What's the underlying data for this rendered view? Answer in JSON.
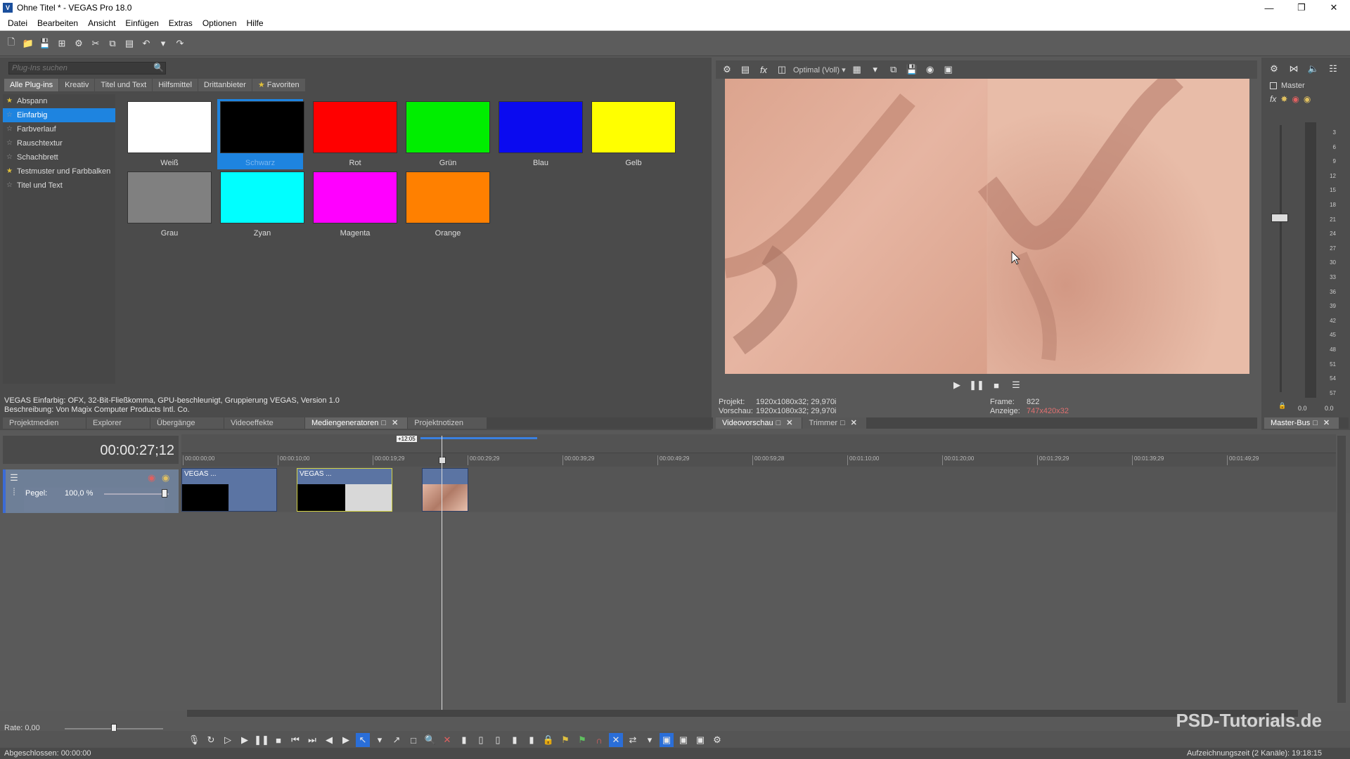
{
  "window": {
    "title": "Ohne Titel * - VEGAS Pro 18.0",
    "icon_letter": "V"
  },
  "menu": [
    "Datei",
    "Bearbeiten",
    "Ansicht",
    "Einfügen",
    "Extras",
    "Optionen",
    "Hilfe"
  ],
  "plugins": {
    "search_placeholder": "Plug-Ins suchen",
    "tabs": [
      "Alle Plug-ins",
      "Kreativ",
      "Titel und Text",
      "Hilfsmittel",
      "Drittanbieter",
      "Favoriten"
    ],
    "tree": [
      {
        "label": "Abspann",
        "fav": true
      },
      {
        "label": "Einfarbig",
        "fav": false,
        "selected": true
      },
      {
        "label": "Farbverlauf",
        "fav": false
      },
      {
        "label": "Rauschtextur",
        "fav": false
      },
      {
        "label": "Schachbrett",
        "fav": false
      },
      {
        "label": "Testmuster und Farbbalken",
        "fav": true
      },
      {
        "label": "Titel und Text",
        "fav": false
      }
    ],
    "swatches": [
      {
        "label": "Weiß",
        "color": "#ffffff"
      },
      {
        "label": "Schwarz",
        "color": "#000000",
        "selected": true
      },
      {
        "label": "Rot",
        "color": "#ff0000"
      },
      {
        "label": "Grün",
        "color": "#00ee00"
      },
      {
        "label": "Blau",
        "color": "#0a0af0"
      },
      {
        "label": "Gelb",
        "color": "#ffff00"
      },
      {
        "label": "Grau",
        "color": "#808080"
      },
      {
        "label": "Zyan",
        "color": "#00ffff"
      },
      {
        "label": "Magenta",
        "color": "#ff00ff"
      },
      {
        "label": "Orange",
        "color": "#ff8000"
      }
    ],
    "desc_line1": "VEGAS Einfarbig: OFX, 32-Bit-Fließkomma, GPU-beschleunigt, Gruppierung VEGAS, Version 1.0",
    "desc_line2": "Beschreibung: Von Magix Computer Products Intl. Co."
  },
  "left_dock_tabs": [
    "Projektmedien",
    "Explorer",
    "Übergänge",
    "Videoeffekte",
    "Mediengeneratoren",
    "Projektnotizen"
  ],
  "preview": {
    "quality": "Optimal (Voll)",
    "projekt_label": "Projekt:",
    "projekt_value": "1920x1080x32; 29,970i",
    "vorschau_label": "Vorschau:",
    "vorschau_value": "1920x1080x32; 29,970i",
    "frame_label": "Frame:",
    "frame_value": "822",
    "anzeige_label": "Anzeige:",
    "anzeige_value": "747x420x32",
    "tabs": [
      "Videovorschau",
      "Trimmer"
    ]
  },
  "master": {
    "label": "Master",
    "scale": [
      "3",
      "6",
      "9",
      "12",
      "15",
      "18",
      "21",
      "24",
      "27",
      "30",
      "33",
      "36",
      "39",
      "42",
      "45",
      "48",
      "51",
      "54",
      "57"
    ],
    "bottom_values": [
      "0.0",
      "0.0"
    ],
    "tab": "Master-Bus"
  },
  "timeline": {
    "timecode": "00:00:27;12",
    "marker": "+12:05",
    "ruler_ticks": [
      "00:00:00;00",
      "00:00:10;00",
      "00:00:19;29",
      "00:00:29;29",
      "00:00:39;29",
      "00:00:49;29",
      "00:00:59;28",
      "00:01:10;00",
      "00:01:20;00",
      "00:01:29;29",
      "00:01:39;29",
      "00:01:49;29"
    ],
    "pegel_label": "Pegel:",
    "pegel_value": "100,0 %",
    "clips": [
      {
        "name": "VEGAS ..."
      },
      {
        "name": "VEGAS ..."
      },
      {
        "name": ""
      }
    ],
    "rate": "Rate: 0,00"
  },
  "status": {
    "left": "Abgeschlossen: 00:00:00",
    "right": "Aufzeichnungszeit (2 Kanäle): 19:18:15"
  },
  "watermark": "PSD-Tutorials.de"
}
